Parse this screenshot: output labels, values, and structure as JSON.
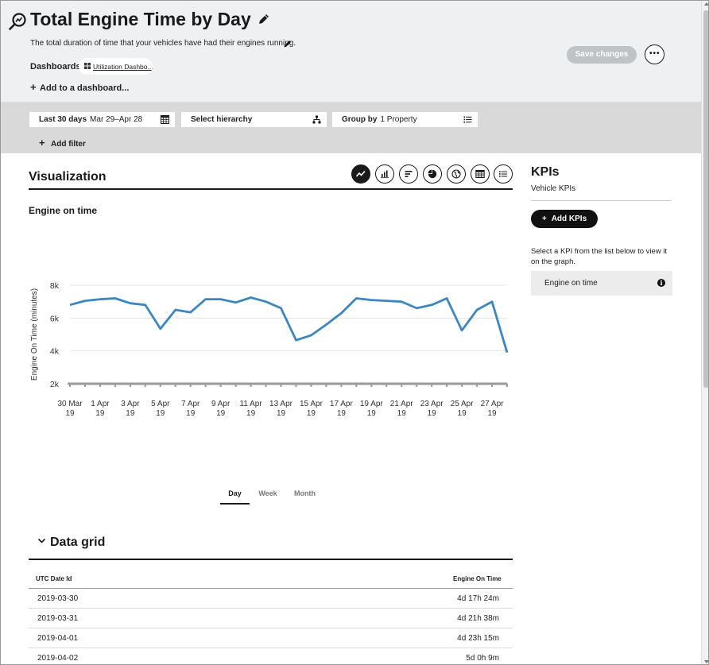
{
  "header": {
    "title": "Total Engine Time by Day",
    "description": "The total duration of time that your vehicles have had their engines running.",
    "dashboards_label": "Dashboards:",
    "dashboard_chip": "Utilization Dashbo...",
    "add_dashboard": "Add to a dashboard...",
    "save_label": "Save changes",
    "more_label": "•••"
  },
  "filters": {
    "date_range_label": "Last 30 days",
    "date_range_value": "Mar 29–Apr 28",
    "hierarchy_label": "Select hierarchy",
    "group_by_label": "Group by",
    "group_by_value": "1 Property",
    "add_filter": "Add filter"
  },
  "visualization": {
    "title": "Visualization",
    "buttons": [
      "line-chart-icon",
      "bar-chart-icon",
      "horizontal-bar-icon",
      "pie-chart-icon",
      "map-icon",
      "table-icon",
      "list-icon"
    ],
    "active_button": "line-chart-icon",
    "chart_title": "Engine on time",
    "tabs": [
      "Day",
      "Week",
      "Month"
    ],
    "active_tab": "Day"
  },
  "chart_data": {
    "type": "line",
    "title": "Engine on time",
    "xlabel": "",
    "ylabel": "Engine On Time (minutes)",
    "ylim": [
      2000,
      8000
    ],
    "yticks": [
      2000,
      4000,
      6000,
      8000
    ],
    "ytick_labels": [
      "2k",
      "4k",
      "6k",
      "8k"
    ],
    "xtick_labels": [
      "30 Mar 19",
      "1 Apr 19",
      "3 Apr 19",
      "5 Apr 19",
      "7 Apr 19",
      "9 Apr 19",
      "11 Apr 19",
      "13 Apr 19",
      "15 Apr 19",
      "17 Apr 19",
      "19 Apr 19",
      "21 Apr 19",
      "23 Apr 19",
      "25 Apr 19",
      "27 Apr 19"
    ],
    "grid": true,
    "color": "#3a87c8",
    "series": [
      {
        "values": [
          6800,
          7050,
          7150,
          7200,
          6900,
          6800,
          5350,
          6500,
          6350,
          7150,
          7150,
          6950,
          7250,
          7000,
          6600,
          4650,
          4950,
          5600,
          6300,
          7200,
          7100,
          7050,
          7000,
          6600,
          6800,
          7200,
          5250,
          6500,
          7000,
          3900
        ]
      }
    ]
  },
  "data_grid": {
    "title": "Data grid",
    "columns": [
      "UTC Date Id",
      "Engine On Time"
    ],
    "rows": [
      [
        "2019-03-30",
        "4d 17h 24m"
      ],
      [
        "2019-03-31",
        "4d 21h 38m"
      ],
      [
        "2019-04-01",
        "4d 23h 15m"
      ],
      [
        "2019-04-02",
        "5d 0h 9m"
      ]
    ]
  },
  "kpis": {
    "title": "KPIs",
    "subtitle": "Vehicle KPIs",
    "add_label": "Add KPIs",
    "help": "Select a KPI from the list below to view it on the graph.",
    "items": [
      "Engine on time"
    ]
  }
}
